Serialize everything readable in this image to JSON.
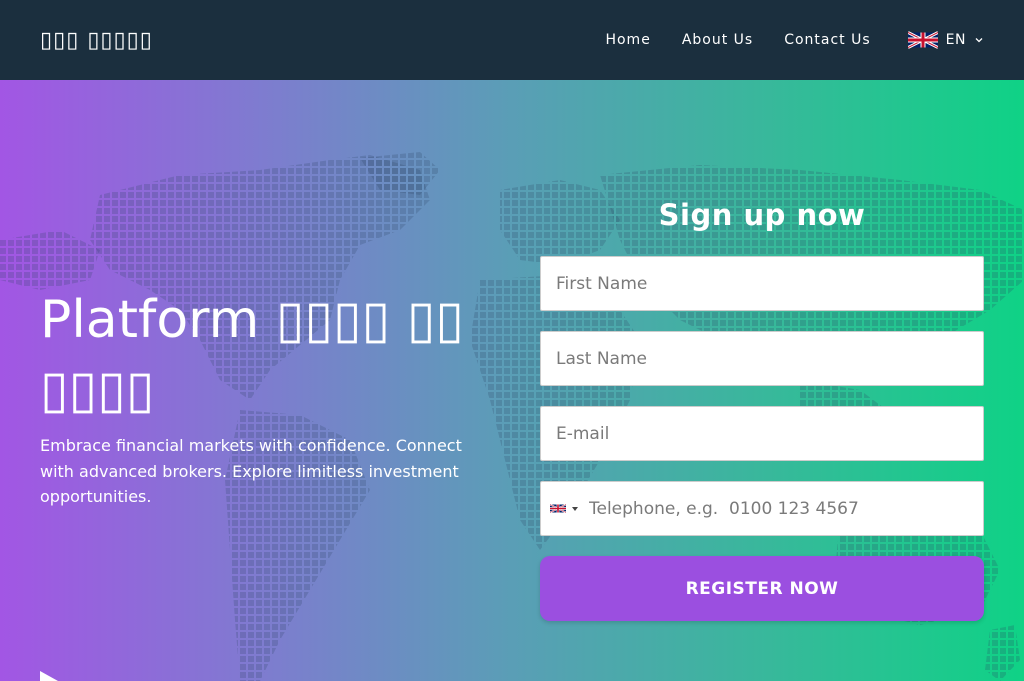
{
  "nav": {
    "brand": "▯▯▯ ▯▯▯▯▯",
    "links": [
      "Home",
      "About Us",
      "Contact Us"
    ],
    "language": {
      "code": "EN",
      "flag_icon": "uk-flag-icon"
    }
  },
  "hero": {
    "title": "Platform ▯▯▯▯ ▯▯ ▯▯▯▯",
    "subtitle": "Embrace financial markets with confidence. Connect with advanced brokers. Explore limitless investment opportunities."
  },
  "form": {
    "title": "Sign up now",
    "first_name_placeholder": "First Name",
    "last_name_placeholder": "Last Name",
    "email_placeholder": "E-mail",
    "telephone_placeholder": "Telephone, e.g.  0100 123 4567",
    "register_label": "REGISTER NOW"
  },
  "colors": {
    "navbar_bg": "#1b2f3e",
    "gradient_start": "#a256e4",
    "gradient_end": "#0fd286",
    "button_bg": "#9b4fe0"
  }
}
